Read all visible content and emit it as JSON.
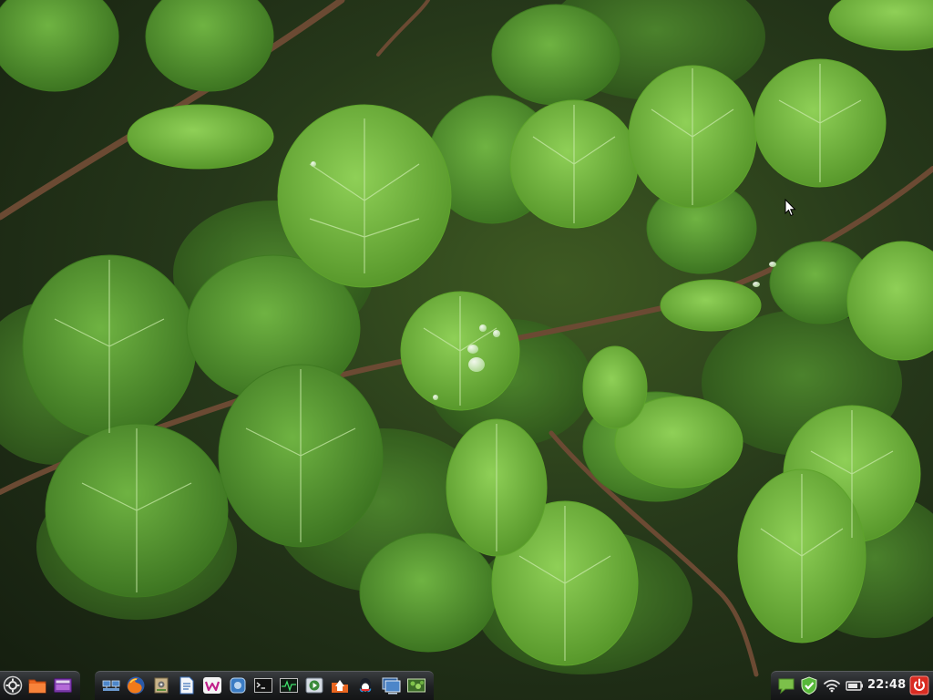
{
  "desktop": {
    "wallpaper": "green-leaves-photo",
    "accent_color": "#6fbf3a"
  },
  "taskbar": {
    "left_panel": [
      {
        "name": "app-menu-icon"
      },
      {
        "name": "file-manager-icon"
      },
      {
        "name": "media-player-icon"
      }
    ],
    "launchers": [
      {
        "name": "network-places-icon"
      },
      {
        "name": "firefox-icon"
      },
      {
        "name": "system-settings-icon"
      },
      {
        "name": "document-writer-icon"
      },
      {
        "name": "wps-office-icon"
      },
      {
        "name": "software-center-icon"
      },
      {
        "name": "terminal-icon"
      },
      {
        "name": "system-monitor-icon"
      },
      {
        "name": "video-player-icon"
      },
      {
        "name": "home-folder-icon"
      },
      {
        "name": "qq-chat-icon"
      },
      {
        "name": "display-settings-icon"
      },
      {
        "name": "wallpaper-viewer-icon"
      }
    ],
    "tray": [
      {
        "name": "chat-bubble-icon"
      },
      {
        "name": "security-check-icon"
      },
      {
        "name": "wifi-icon"
      },
      {
        "name": "battery-icon"
      },
      {
        "name": "power-icon"
      }
    ],
    "clock_time": "22:48"
  }
}
